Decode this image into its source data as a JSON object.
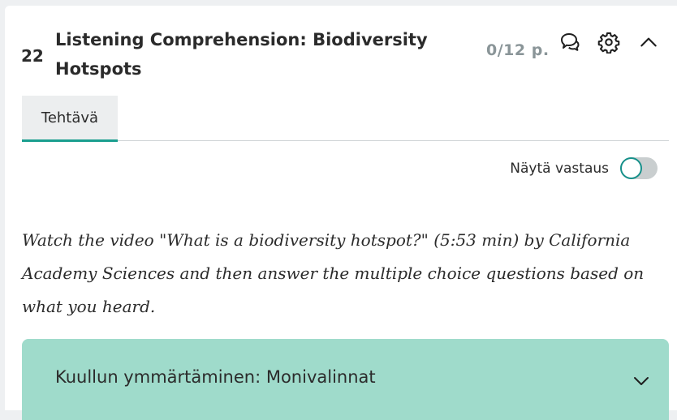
{
  "question": {
    "number": "22",
    "title": "Listening Comprehension: Biodiversity Hotspots",
    "points": "0/12 p."
  },
  "icons": {
    "comment": "comment-bubbles-icon",
    "settings": "gear-icon",
    "collapse": "chevron-up-icon",
    "accordion": "chevron-down-icon"
  },
  "tabs": [
    {
      "label": "Tehtävä",
      "active": true
    }
  ],
  "show_answer": {
    "label": "Näytä vastaus",
    "enabled": false
  },
  "instructions": "Watch the video \"What is a biodiversity hotspot?\" (5:53 min) by California Academy Sciences and then answer the multiple choice questions based on what you heard.",
  "section": {
    "title": "Kuullun ymmärtäminen: Monivalinnat"
  },
  "colors": {
    "accent": "#1a9e8f",
    "section_bg": "#9fdbcb",
    "points": "#8a9598"
  }
}
